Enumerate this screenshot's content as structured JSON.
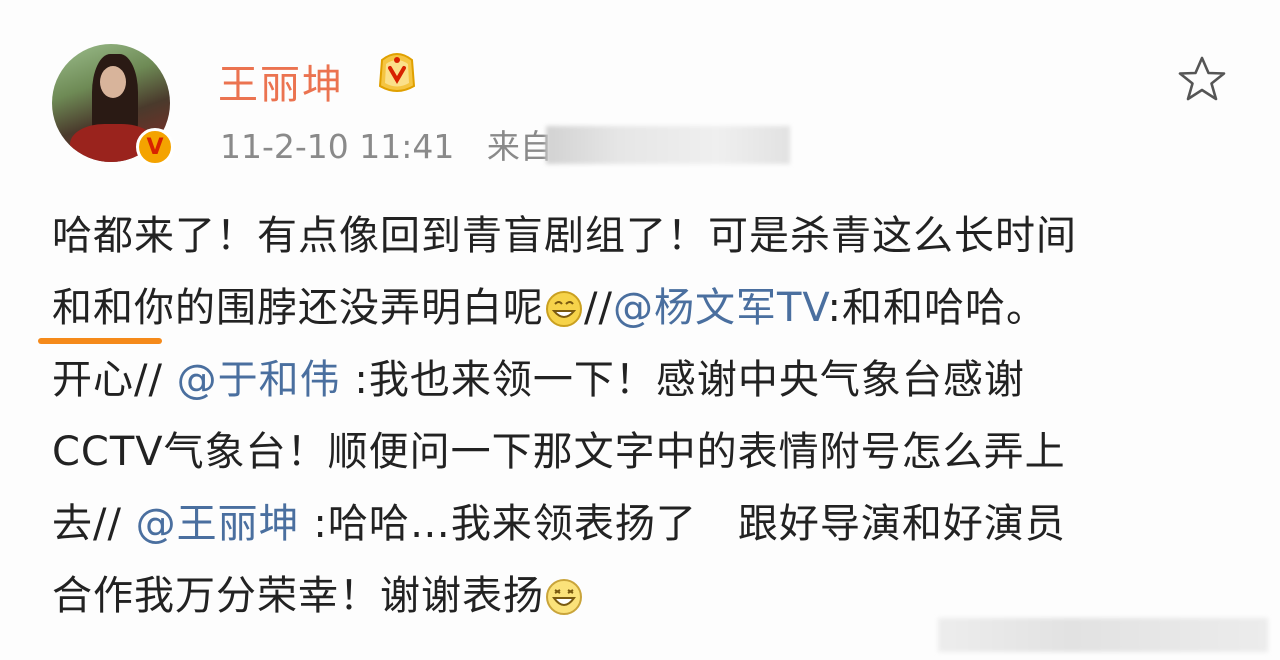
{
  "post": {
    "username": "王丽坤",
    "timestamp": "11-2-10 11:41",
    "source_label": "来自",
    "icons": {
      "avatar": "user-avatar",
      "verified": "verified-v-badge",
      "vip": "vip-member-icon",
      "favorite": "star-icon",
      "emoji_1": "grin-emoji",
      "emoji_2": "laugh-emoji"
    },
    "colors": {
      "username": "#eb7350",
      "mention": "#4a6f9f",
      "highlight_underline": "#f58a1a",
      "meta": "#8a8a8a"
    },
    "content": {
      "line1": "哈都来了！有点像回到青盲剧组了！可是杀青这么长时间",
      "line2_text": "和和你的围脖还没弄明白呢",
      "line2_sep": "//",
      "line2_mention": "@杨文军TV",
      "line2_rest": ":和和哈哈。",
      "line3_text": "开心//",
      "line3_mention": "@于和伟",
      "line3_rest": ":我也来领一下！感谢中央气象台感谢",
      "line4": "CCTV气象台！顺便问一下那文字中的表情附号怎么弄上",
      "line5_text": "去//",
      "line5_mention": "@王丽坤",
      "line5_rest": ":哈哈…我来领表扬了　跟好导演和好演员",
      "line6_text": "合作我万分荣幸！谢谢表扬"
    }
  }
}
